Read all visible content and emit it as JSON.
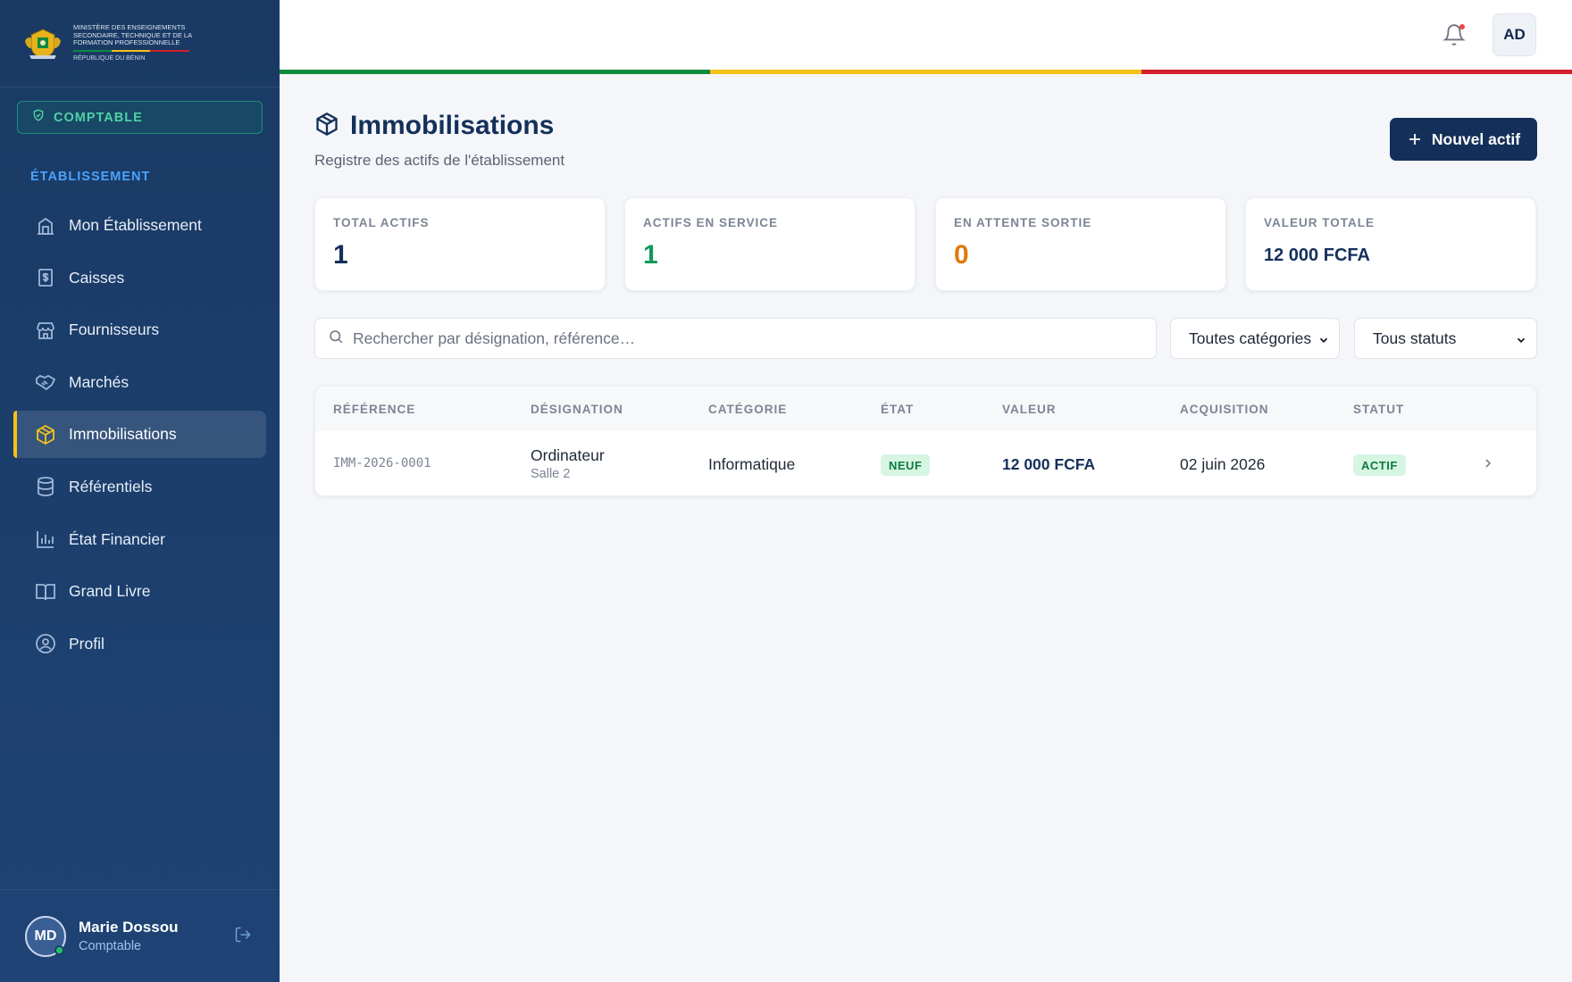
{
  "brand": {
    "ministry": "Ministère des Enseignements Secondaire, Technique et de la Formation Professionnelle",
    "republic": "République du Bénin"
  },
  "role_badge": "COMPTABLE",
  "section_title": "ÉTABLISSEMENT",
  "nav": [
    {
      "label": "Mon Établissement",
      "icon": "building-icon",
      "active": false
    },
    {
      "label": "Caisses",
      "icon": "cash-register-icon",
      "active": false
    },
    {
      "label": "Fournisseurs",
      "icon": "store-icon",
      "active": false
    },
    {
      "label": "Marchés",
      "icon": "handshake-icon",
      "active": false
    },
    {
      "label": "Immobilisations",
      "icon": "package-icon",
      "active": true
    },
    {
      "label": "Référentiels",
      "icon": "database-icon",
      "active": false
    },
    {
      "label": "État Financier",
      "icon": "bar-chart-icon",
      "active": false
    },
    {
      "label": "Grand Livre",
      "icon": "book-open-icon",
      "active": false
    },
    {
      "label": "Profil",
      "icon": "user-circle-icon",
      "active": false
    }
  ],
  "user": {
    "initials": "MD",
    "name": "Marie Dossou",
    "role": "Comptable"
  },
  "topbar": {
    "avatar_initials": "AD"
  },
  "colors": {
    "flag_green": "#0b8a3e",
    "flag_yellow": "#f4c21a",
    "flag_red": "#d21f2a",
    "primary": "#14305a"
  },
  "page": {
    "title": "Immobilisations",
    "subtitle": "Registre des actifs de l'établissement",
    "new_button": "Nouvel actif"
  },
  "stats": [
    {
      "label": "TOTAL ACTIFS",
      "value": "1",
      "color": "#14305a"
    },
    {
      "label": "ACTIFS EN SERVICE",
      "value": "1",
      "color": "#0f9a5a"
    },
    {
      "label": "EN ATTENTE SORTIE",
      "value": "0",
      "color": "#e07a10"
    },
    {
      "label": "VALEUR TOTALE",
      "value": "12 000 FCFA",
      "color": "#14305a"
    }
  ],
  "filters": {
    "search_placeholder": "Rechercher par désignation, référence…",
    "category": "Toutes catégories",
    "status": "Tous statuts"
  },
  "table": {
    "headers": [
      "RÉFÉRENCE",
      "DÉSIGNATION",
      "CATÉGORIE",
      "ÉTAT",
      "VALEUR",
      "ACQUISITION",
      "STATUT"
    ],
    "rows": [
      {
        "reference": "IMM-2026-0001",
        "designation": "Ordinateur",
        "location": "Salle 2",
        "category": "Informatique",
        "state": "NEUF",
        "value": "12 000 FCFA",
        "acquisition": "02 juin 2026",
        "status": "ACTIF"
      }
    ]
  }
}
